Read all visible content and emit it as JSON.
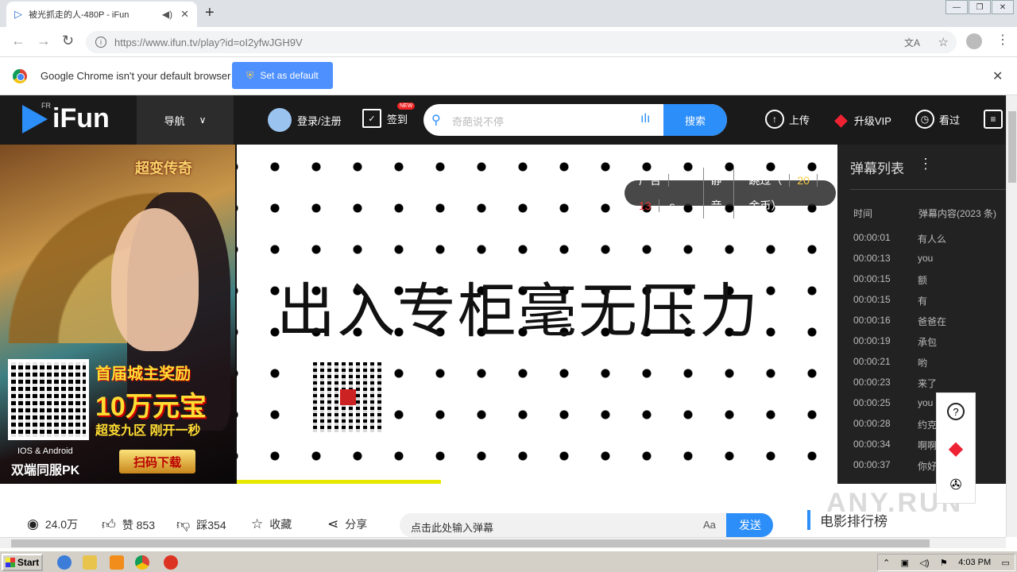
{
  "browser": {
    "tab_title": "被光抓走的人-480P - iFun",
    "url": "https://www.ifun.tv/play?id=oI2yfwJGH9V",
    "infobar_text": "Google Chrome isn't your default browser",
    "set_default_label": "Set as default"
  },
  "site": {
    "brand": "iFun",
    "brand_sup": "FR",
    "nav_label": "导航",
    "login_label": "登录/注册",
    "checkin_label": "签到",
    "new_badge": "NEW",
    "search_placeholder": "奇葩说不停",
    "search_button": "搜索",
    "upload_label": "上传",
    "vip_label": "升级VIP",
    "history_label": "看过"
  },
  "left_ad": {
    "game_title": "超变传奇",
    "promo_line1": "首届城主奖励",
    "promo_line2": "10万元宝",
    "promo_line3": "超变九区 刚开一秒",
    "platform": "IOS & Android",
    "pk": "双端同服PK",
    "download": "扫码下载"
  },
  "video": {
    "caption": "出入专柜毫无压力",
    "ad_label": "广告",
    "ad_seconds": "13",
    "ad_unit": "s",
    "mute_label": "静音",
    "skip_prefix": "跳过（",
    "skip_coins": "20",
    "skip_suffix": "金币）",
    "progress_fraction": 0.34
  },
  "danmu": {
    "title": "弹幕列表",
    "col_time": "时间",
    "col_content": "弹幕内容(2023 条)",
    "rows": [
      {
        "time": "00:00:01",
        "msg": "有人么"
      },
      {
        "time": "00:00:13",
        "msg": "you"
      },
      {
        "time": "00:00:15",
        "msg": "额"
      },
      {
        "time": "00:00:15",
        "msg": "有"
      },
      {
        "time": "00:00:16",
        "msg": "爸爸在"
      },
      {
        "time": "00:00:19",
        "msg": "承包"
      },
      {
        "time": "00:00:21",
        "msg": "哟"
      },
      {
        "time": "00:00:23",
        "msg": "来了"
      },
      {
        "time": "00:00:25",
        "msg": "you"
      },
      {
        "time": "00:00:28",
        "msg": "约克"
      },
      {
        "time": "00:00:34",
        "msg": "啊啊"
      },
      {
        "time": "00:00:37",
        "msg": "你好"
      }
    ]
  },
  "actions": {
    "views": "24.0万",
    "likes": "赞 853",
    "dislikes": "踩354",
    "favorite": "收藏",
    "share": "分享",
    "danmu_placeholder": "点击此处输入弹幕",
    "font_toggle": "Aa",
    "send": "发送",
    "ranking": "电影排行榜"
  },
  "watermark": "ANY.RUN",
  "taskbar": {
    "start": "Start",
    "time": "4:03 PM"
  },
  "colors": {
    "accent": "#2c8ef8",
    "header_bg": "#1a1a1a",
    "danmu_bg": "#222222"
  }
}
